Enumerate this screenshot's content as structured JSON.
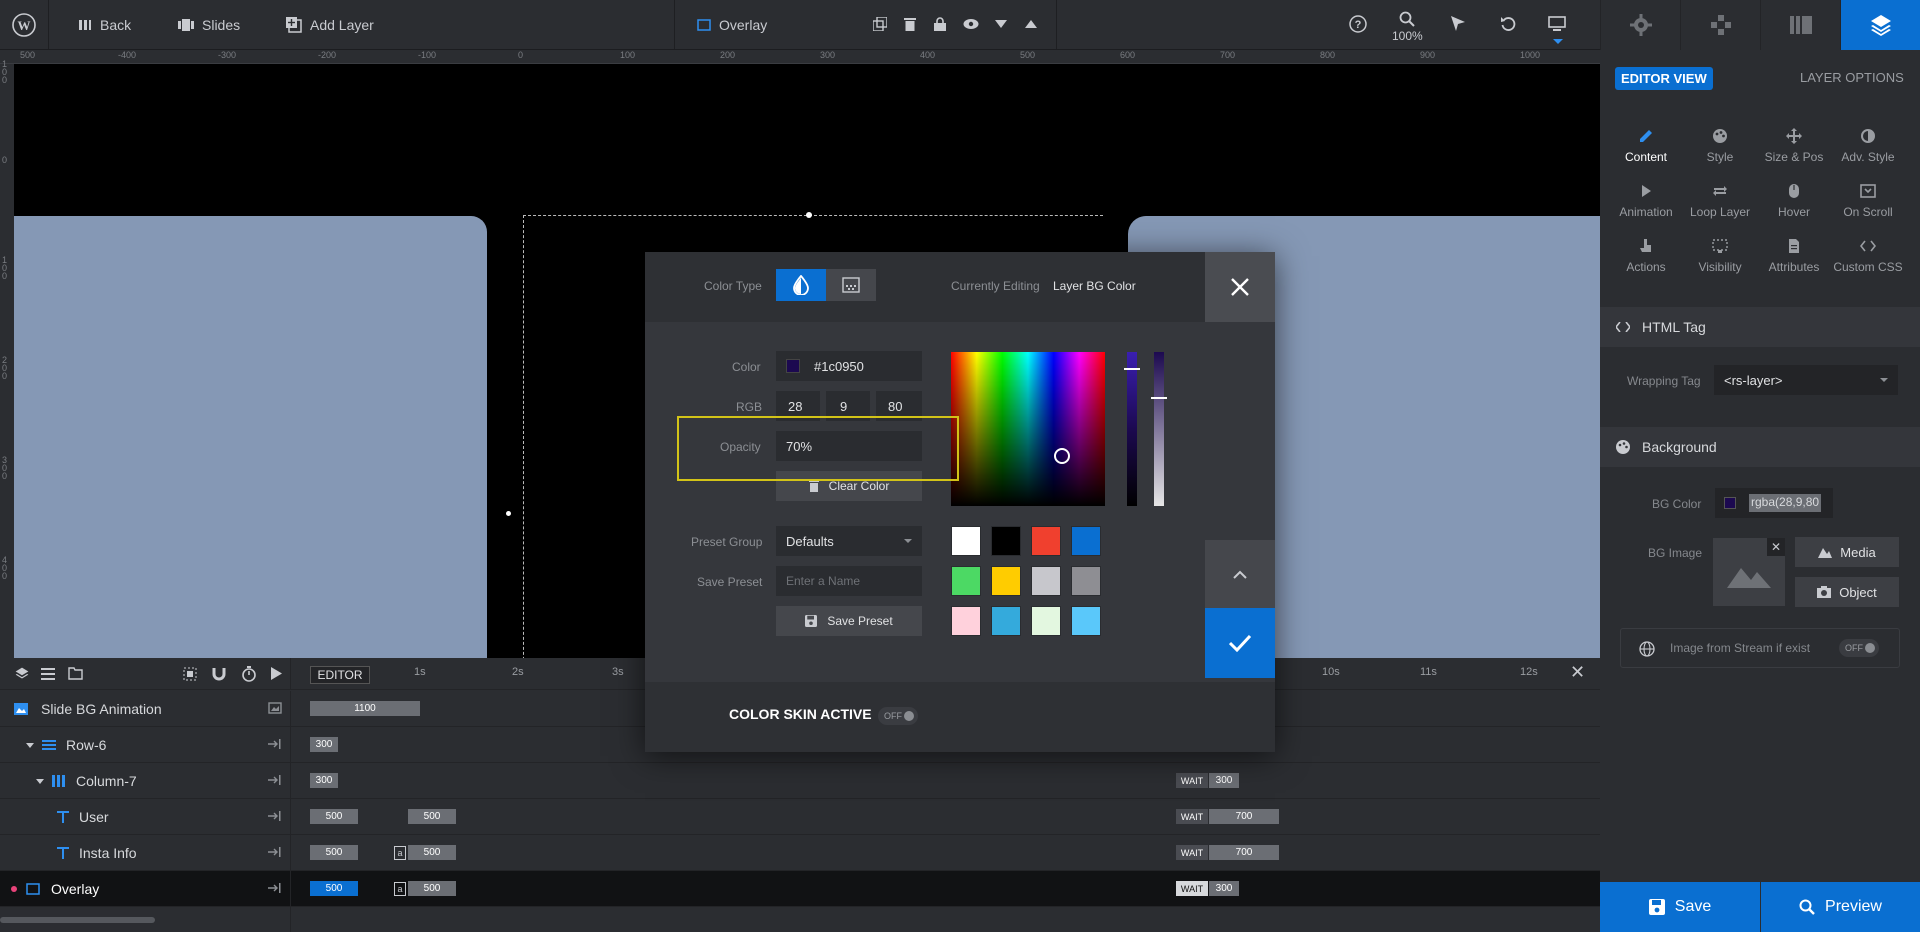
{
  "topbar": {
    "back_label": "Back",
    "slides_label": "Slides",
    "add_layer_label": "Add Layer",
    "layer_name": "Overlay",
    "zoom": "100%"
  },
  "right_tabs": [
    "settings",
    "gamepad",
    "library",
    "layers"
  ],
  "panel": {
    "editor_view": "EDITOR VIEW",
    "layer_options": "LAYER OPTIONS",
    "options": [
      {
        "label": "Content",
        "icon": "pencil-icon"
      },
      {
        "label": "Style",
        "icon": "palette-icon"
      },
      {
        "label": "Size & Pos",
        "icon": "move-icon"
      },
      {
        "label": "Adv. Style",
        "icon": "contrast-icon"
      },
      {
        "label": "Animation",
        "icon": "play-icon"
      },
      {
        "label": "Loop Layer",
        "icon": "loop-icon"
      },
      {
        "label": "Hover",
        "icon": "mouse-icon"
      },
      {
        "label": "On Scroll",
        "icon": "scroll-icon"
      },
      {
        "label": "Actions",
        "icon": "hand-icon"
      },
      {
        "label": "Visibility",
        "icon": "visibility-icon"
      },
      {
        "label": "Attributes",
        "icon": "document-icon"
      },
      {
        "label": "Custom CSS",
        "icon": "code-icon"
      }
    ],
    "html_tag_title": "HTML Tag",
    "wrapping_tag_label": "Wrapping Tag",
    "wrapping_tag_value": "<rs-layer>",
    "background_title": "Background",
    "bg_color_label": "BG Color",
    "bg_color_value": "rgba(28,9,80",
    "bg_image_label": "BG Image",
    "media_label": "Media",
    "object_label": "Object",
    "stream_label": "Image from Stream if exist",
    "stream_toggle": "OFF",
    "save_label": "Save",
    "preview_label": "Preview"
  },
  "ruler": {
    "h_ticks": [
      "500",
      "-400",
      "-300",
      "-200",
      "-100",
      "0",
      "100",
      "200",
      "300",
      "400",
      "500",
      "600",
      "700",
      "800",
      "900",
      "1000"
    ],
    "v_ticks": [
      "100",
      "0",
      "100",
      "200",
      "300",
      "400"
    ]
  },
  "timeline": {
    "editor_label": "EDITOR",
    "time_marks": [
      "1s",
      "2s",
      "3s",
      "10s",
      "11s",
      "12s"
    ],
    "rows": [
      {
        "name": "Slide BG Animation",
        "chips": [
          "1100"
        ],
        "wait": "",
        "end": ""
      },
      {
        "name": "Row-6",
        "chips": [
          "300"
        ],
        "wait": "",
        "end": ""
      },
      {
        "name": "Column-7",
        "chips": [
          "300"
        ],
        "wait": "WAIT",
        "end": "300"
      },
      {
        "name": "User",
        "chips": [
          "500",
          "500"
        ],
        "wait": "WAIT",
        "end": "700"
      },
      {
        "name": "Insta Info",
        "chips": [
          "500",
          "500"
        ],
        "wait": "WAIT",
        "end": "700"
      },
      {
        "name": "Overlay",
        "chips": [
          "500",
          "500"
        ],
        "wait": "WAIT",
        "end": "300"
      }
    ]
  },
  "modal": {
    "color_type_label": "Color Type",
    "currently_editing_label": "Currently Editing",
    "currently_editing_value": "Layer BG Color",
    "color_label": "Color",
    "color_hex": "#1c0950",
    "rgb_label": "RGB",
    "r": "28",
    "g": "9",
    "b": "80",
    "opacity_label": "Opacity",
    "opacity_value": "70%",
    "clear_color_label": "Clear Color",
    "preset_group_label": "Preset Group",
    "preset_group_value": "Defaults",
    "save_preset_label": "Save Preset",
    "save_preset_placeholder": "Enter a Name",
    "save_preset_button": "Save Preset",
    "color_skin_label": "COLOR SKIN ACTIVE",
    "color_skin_toggle": "OFF",
    "swatches": [
      "#ffffff",
      "#000000",
      "#f0402e",
      "#0a6fd1",
      "#4cd964",
      "#ffcc00",
      "#c7c7cc",
      "#8e8e93",
      "#ffd1dc",
      "#34aadc",
      "#e3f7e0",
      "#5ac8fa"
    ],
    "selected_color": "#1c0950"
  }
}
